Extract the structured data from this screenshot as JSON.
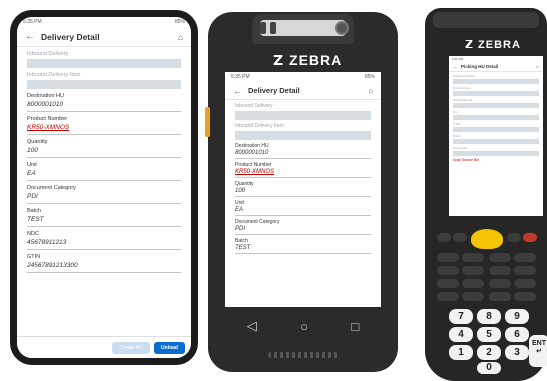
{
  "screen_common": {
    "back_icon": "arrow-left-icon",
    "home_icon": "home-icon",
    "title": "Delivery Detail"
  },
  "device1": {
    "status_time": "5:35 PM",
    "status_right": "85%",
    "fields": [
      {
        "label": "Inbound Delivery",
        "value": "",
        "kind": "bar"
      },
      {
        "label": "Inbound Delivery Item",
        "value": "",
        "kind": "bar"
      },
      {
        "label": "Destination HU",
        "value": "8000001010",
        "kind": "text"
      },
      {
        "label": "Product Number",
        "value": "KR50-XMNOS",
        "kind": "link"
      },
      {
        "label": "Quantity",
        "value": "100",
        "kind": "text"
      },
      {
        "label": "Unit",
        "value": "EA",
        "kind": "text"
      },
      {
        "label": "Document Category",
        "value": "PDI",
        "kind": "text"
      },
      {
        "label": "Batch",
        "value": "TEST",
        "kind": "text"
      },
      {
        "label": "NDC",
        "value": "45678911213",
        "kind": "text"
      },
      {
        "label": "GTIN",
        "value": "24567891213300",
        "kind": "text"
      }
    ],
    "buttons": {
      "create_hu": "Create HU",
      "unload": "Unload"
    }
  },
  "device2": {
    "brand": "ZEBRA",
    "status_time": "5:35 PM",
    "status_right": "85%",
    "fields": [
      {
        "label": "Inbound Delivery",
        "value": "",
        "kind": "bar"
      },
      {
        "label": "Inbound Delivery Item",
        "value": "",
        "kind": "bar"
      },
      {
        "label": "Destination HU",
        "value": "8000001010",
        "kind": "text"
      },
      {
        "label": "Product Number",
        "value": "KR50-XMNOS",
        "kind": "link"
      },
      {
        "label": "Quantity",
        "value": "100",
        "kind": "text"
      },
      {
        "label": "Unit",
        "value": "EA",
        "kind": "text"
      },
      {
        "label": "Document Category",
        "value": "PDI",
        "kind": "text"
      },
      {
        "label": "Batch",
        "value": "TEST",
        "kind": "text"
      }
    ],
    "nav": {
      "back": "◁",
      "home": "○",
      "recent": "□"
    }
  },
  "device3": {
    "brand": "ZEBRA",
    "title": "Picking HU Detail",
    "fields": [
      {
        "label": "Delivery Number"
      },
      {
        "label": "Delivery Item"
      },
      {
        "label": "Stock Material"
      },
      {
        "label": "HU"
      },
      {
        "label": "GTIN"
      },
      {
        "label": "Batch"
      },
      {
        "label": "Source Bin"
      }
    ],
    "error_text": "Scan Source Bin",
    "keys": [
      "7",
      "8",
      "9",
      "4",
      "5",
      "6",
      "1",
      "2",
      "3",
      "0"
    ],
    "ent_label": "ENT"
  },
  "colors": {
    "accent": "#0a6ed1",
    "link": "#bb0000",
    "nav_key": "#f5c400"
  }
}
